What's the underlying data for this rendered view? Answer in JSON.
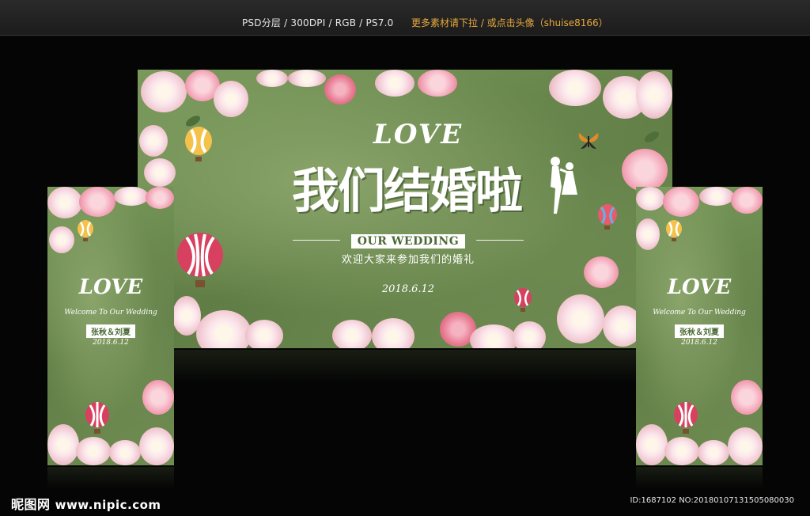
{
  "topbar": {
    "spec": "PSD分层 / 300DPI / RGB / PS7.0",
    "more": "更多素材请下拉 / 或点击头像（shuise8166）"
  },
  "main_board": {
    "love": "LOVE",
    "title": "我们结婚啦",
    "our_wedding": "OUR WEDDING",
    "welcome_cn": "欢迎大家来参加我们的婚礼",
    "date": "2018.6.12"
  },
  "side_board": {
    "love": "LOVE",
    "welcome": "Welcome To Our Wedding",
    "names": "张秋＆刘夏",
    "date": "2018.6.12"
  },
  "footer": {
    "logo_cn": "昵图网",
    "logo_site": "www.nipic.com",
    "id_line": "ID:1687102 NO:20180107131505080030"
  },
  "colors": {
    "board_green": "#6f8c52",
    "accent_orange": "#e8a83c",
    "background": "#050505"
  }
}
